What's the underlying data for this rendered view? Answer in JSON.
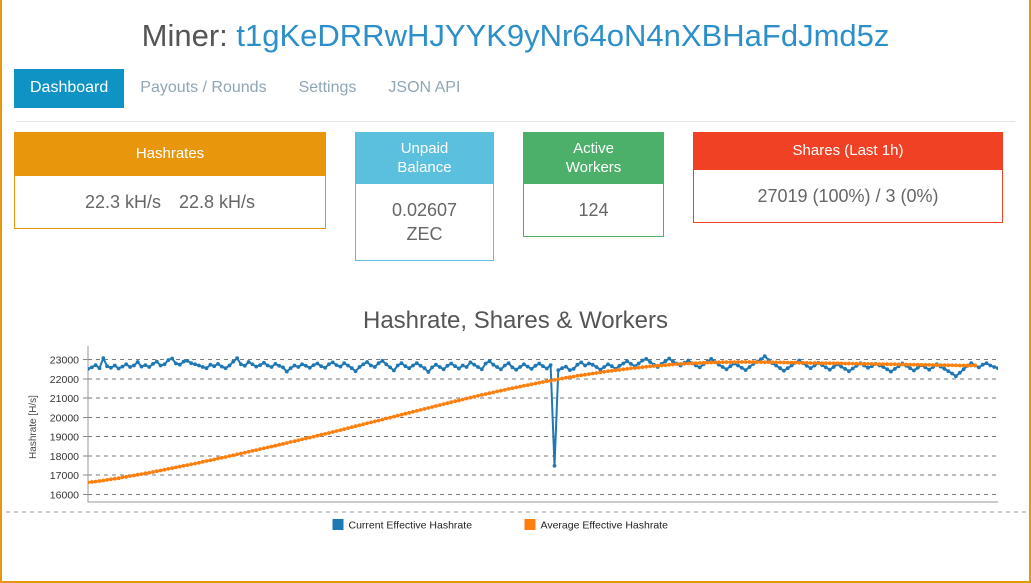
{
  "header": {
    "title_prefix": "Miner:",
    "miner_address": "t1gKeDRRwHJYYK9yNr64oN4nXBHaFdJmd5z"
  },
  "tabs": [
    {
      "label": "Dashboard",
      "active": true
    },
    {
      "label": "Payouts / Rounds",
      "active": false
    },
    {
      "label": "Settings",
      "active": false
    },
    {
      "label": "JSON API",
      "active": false
    }
  ],
  "cards": {
    "hashrates": {
      "title": "Hashrates",
      "value_current": "22.3 kH/s",
      "value_average": "22.8 kH/s",
      "accent": "#E8960C"
    },
    "unpaid_balance": {
      "title_line1": "Unpaid",
      "title_line2": "Balance",
      "value": "0.02607",
      "unit": "ZEC",
      "accent": "#5BC0DE"
    },
    "active_workers": {
      "title_line1": "Active",
      "title_line2": "Workers",
      "value": "124",
      "accent": "#4CAF6A"
    },
    "shares": {
      "title": "Shares (Last 1h)",
      "value": "27019 (100%) / 3 (0%)",
      "accent": "#F04124"
    }
  },
  "chart_data": {
    "type": "line",
    "title": "Hashrate, Shares & Workers",
    "xlabel": "",
    "ylabel": "Hashrate [H/s]",
    "ylim": [
      15600,
      23400
    ],
    "yticks": [
      16000,
      17000,
      18000,
      19000,
      20000,
      21000,
      22000,
      23000
    ],
    "ytick_labels": [
      "16000",
      "17000",
      "18000",
      "19000",
      "20000",
      "21000",
      "22000",
      "23000"
    ],
    "grid": true,
    "xticks_visible": false,
    "legend_position": "bottom",
    "colors": {
      "current": "#1F77B4",
      "average": "#FF7F0E"
    },
    "series": [
      {
        "name": "Current Effective Hashrate",
        "color": "#1F77B4",
        "values": [
          22520,
          22600,
          22720,
          22560,
          23080,
          22660,
          22580,
          22700,
          22540,
          22640,
          22760,
          22620,
          22700,
          22880,
          22640,
          22720,
          22620,
          22780,
          22900,
          22700,
          22760,
          22980,
          23060,
          22800,
          22740,
          22900,
          22940,
          22820,
          22760,
          22700,
          22620,
          22560,
          22740,
          22660,
          22780,
          22640,
          22560,
          22700,
          22900,
          23080,
          22760,
          22680,
          22880,
          22760,
          22640,
          22720,
          22840,
          22700,
          22620,
          22780,
          22680,
          22600,
          22380,
          22560,
          22700,
          22620,
          22760,
          22680,
          22580,
          22720,
          22800,
          22660,
          22580,
          22760,
          22860,
          22720,
          22640,
          22820,
          22700,
          22560,
          22400,
          22620,
          22760,
          22880,
          22700,
          22620,
          22820,
          22940,
          22760,
          22600,
          22440,
          22700,
          22820,
          22660,
          22560,
          22700,
          22820,
          22680,
          22560,
          22360,
          22600,
          22740,
          22620,
          22500,
          22680,
          22800,
          22660,
          22540,
          22700,
          22620,
          22860,
          22740,
          22620,
          22500,
          22800,
          22920,
          22740,
          22620,
          22500,
          22700,
          22820,
          22600,
          22480,
          22620,
          22760,
          22640,
          22520,
          22680,
          22800,
          22660,
          22540,
          22720,
          17480,
          22460,
          22560,
          22640,
          22460,
          22520,
          22740,
          22860,
          22700,
          22800,
          22740,
          22620,
          22480,
          22620,
          22760,
          22660,
          22520,
          22680,
          22800,
          22920,
          22780,
          22660,
          22800,
          22960,
          23040,
          22880,
          22740,
          22620,
          22780,
          22920,
          23060,
          22900,
          22800,
          22700,
          22840,
          22960,
          22820,
          22700,
          22600,
          22760,
          22900,
          23040,
          22880,
          22740,
          22620,
          22500,
          22660,
          22800,
          22700,
          22580,
          22460,
          22620,
          22780,
          22900,
          23020,
          23180,
          22980,
          22820,
          22700,
          22560,
          22420,
          22560,
          22700,
          22840,
          22960,
          22820,
          22680,
          22560,
          22700,
          22840,
          22720,
          22600,
          22480,
          22620,
          22760,
          22640,
          22520,
          22400,
          22540,
          22680,
          22820,
          22700,
          22580,
          22660,
          22780,
          22700,
          22620,
          22500,
          22380,
          22520,
          22660,
          22800,
          22680,
          22560,
          22440,
          22580,
          22720,
          22600,
          22480,
          22620,
          22760,
          22640,
          22520,
          22400,
          22280,
          22140,
          22320,
          22500,
          22680,
          22820,
          22700,
          22600,
          22740,
          22820,
          22700,
          22620,
          22560
        ]
      },
      {
        "name": "Average Effective Hashrate",
        "color": "#FF7F0E",
        "values": [
          16620,
          16640,
          16660,
          16690,
          16720,
          16750,
          16780,
          16810,
          16840,
          16880,
          16910,
          16950,
          16980,
          17020,
          17050,
          17090,
          17120,
          17160,
          17200,
          17240,
          17280,
          17320,
          17360,
          17400,
          17440,
          17480,
          17520,
          17560,
          17600,
          17640,
          17690,
          17730,
          17770,
          17810,
          17860,
          17900,
          17940,
          17990,
          18030,
          18080,
          18120,
          18170,
          18210,
          18260,
          18300,
          18350,
          18390,
          18440,
          18480,
          18530,
          18580,
          18620,
          18670,
          18720,
          18760,
          18810,
          18860,
          18900,
          18950,
          19000,
          19050,
          19100,
          19140,
          19190,
          19240,
          19290,
          19340,
          19390,
          19440,
          19490,
          19540,
          19590,
          19640,
          19690,
          19740,
          19790,
          19840,
          19890,
          19940,
          19990,
          20040,
          20090,
          20140,
          20190,
          20240,
          20290,
          20340,
          20390,
          20440,
          20490,
          20540,
          20590,
          20640,
          20690,
          20740,
          20790,
          20840,
          20880,
          20930,
          20980,
          21030,
          21070,
          21120,
          21170,
          21210,
          21260,
          21300,
          21350,
          21390,
          21430,
          21480,
          21520,
          21560,
          21600,
          21640,
          21680,
          21720,
          21760,
          21800,
          21840,
          21880,
          21910,
          21950,
          21990,
          22020,
          22060,
          22090,
          22120,
          22160,
          22190,
          22220,
          22250,
          22280,
          22310,
          22340,
          22370,
          22400,
          22420,
          22450,
          22470,
          22500,
          22520,
          22550,
          22570,
          22590,
          22610,
          22630,
          22650,
          22670,
          22690,
          22700,
          22720,
          22740,
          22750,
          22770,
          22780,
          22790,
          22800,
          22810,
          22820,
          22830,
          22840,
          22850,
          22855,
          22860,
          22865,
          22870,
          22870,
          22875,
          22875,
          22880,
          22880,
          22880,
          22880,
          22880,
          22875,
          22875,
          22870,
          22870,
          22865,
          22860,
          22860,
          22855,
          22850,
          22850,
          22845,
          22840,
          22840,
          22835,
          22830,
          22830,
          22825,
          22820,
          22820,
          22815,
          22810,
          22810,
          22805,
          22800,
          22800,
          22795,
          22790,
          22790,
          22785,
          22780,
          22780,
          22775,
          22770,
          22770,
          22765,
          22760,
          22760,
          22755,
          22750,
          22750,
          22745,
          22740,
          22740,
          22735,
          22730,
          22730,
          22725,
          22720,
          22720,
          22715,
          22710,
          22710,
          22705,
          22700,
          22700,
          22700,
          22700,
          22700
        ]
      }
    ],
    "legend": [
      {
        "label": "Current Effective Hashrate",
        "color": "#1F77B4"
      },
      {
        "label": "Average Effective Hashrate",
        "color": "#FF7F0E"
      }
    ]
  }
}
